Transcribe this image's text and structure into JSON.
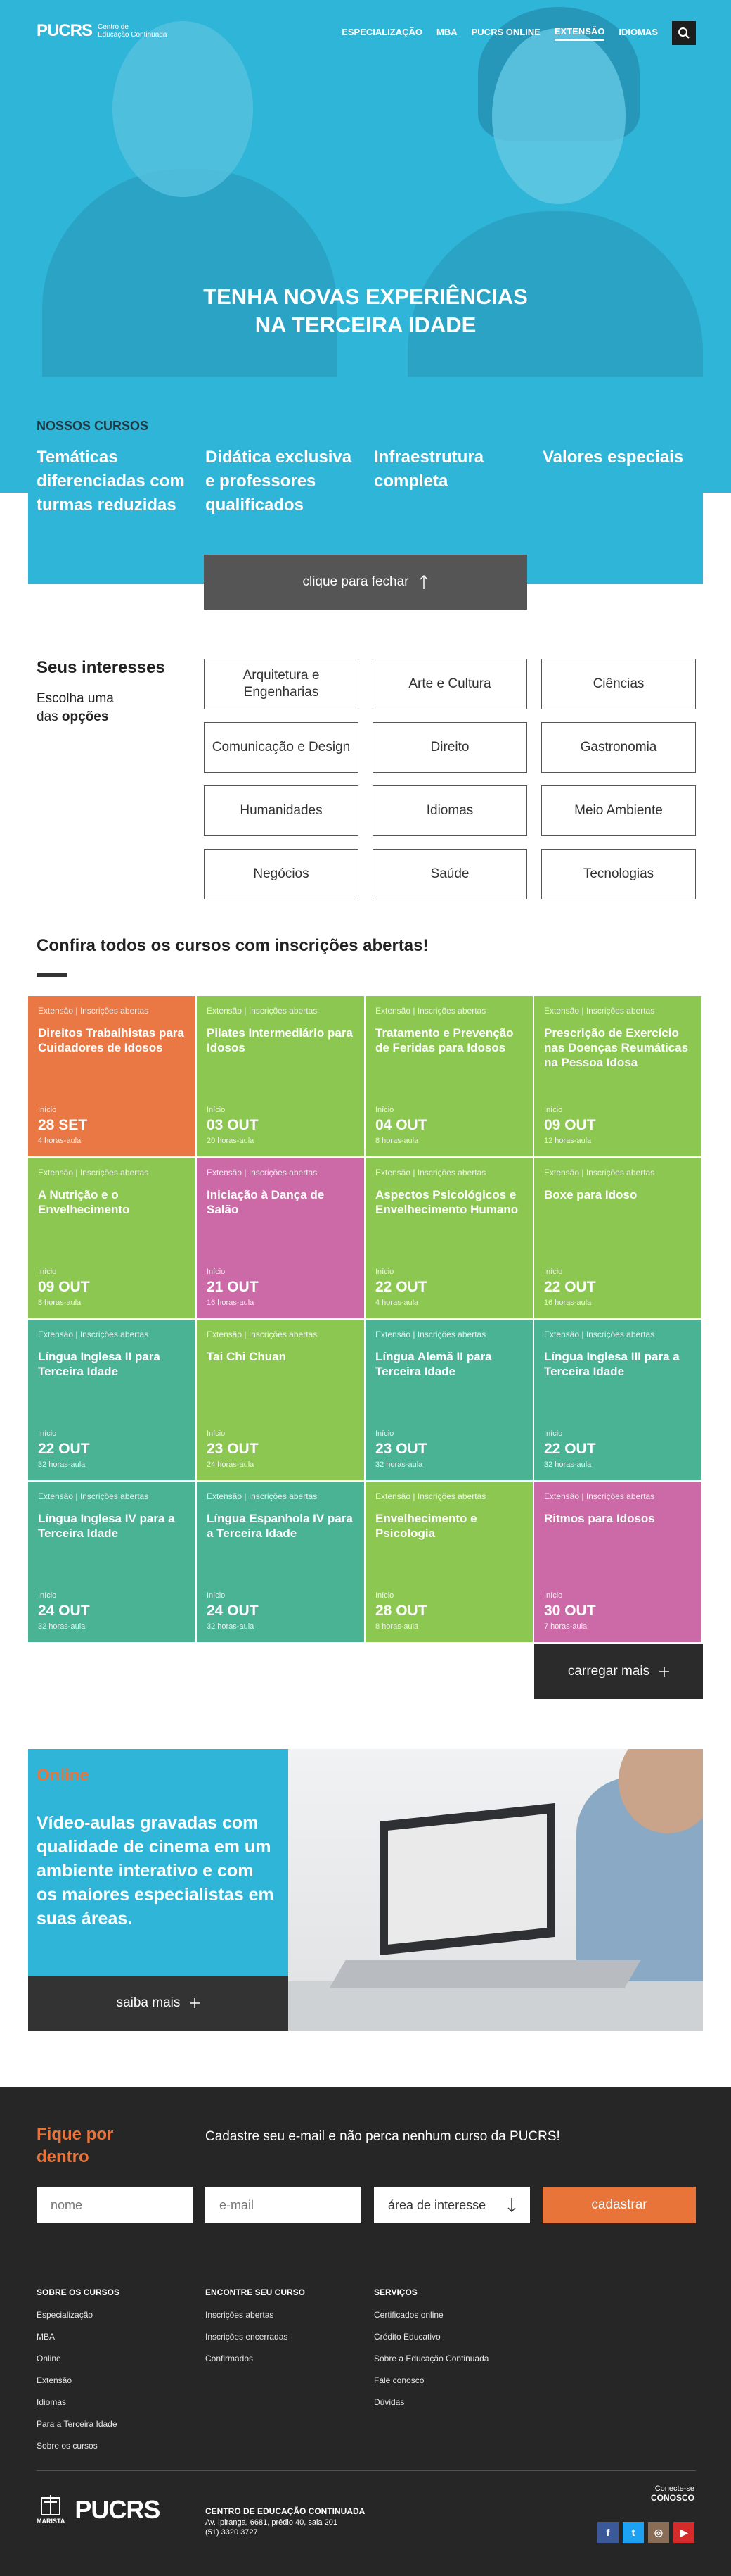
{
  "header": {
    "logo": "PUCRS",
    "logo_sub_line1": "Centro de",
    "logo_sub_line2": "Educação Continuada",
    "nav": [
      "ESPECIALIZAÇÃO",
      "MBA",
      "PUCRS ONLINE",
      "EXTENSÃO",
      "IDIOMAS"
    ],
    "active_nav": "EXTENSÃO"
  },
  "hero": {
    "title_line1": "TENHA NOVAS EXPERIÊNCIAS",
    "title_line2": "NA TERCEIRA IDADE"
  },
  "our_courses": {
    "heading": "NOSSOS CURSOS",
    "features": [
      "Temáticas diferenciadas com turmas reduzidas",
      "Didática exclusiva e professores qualificados",
      "Infraestrutura completa",
      "Valores especiais"
    ],
    "close_label": "clique para fechar",
    "close_icon": "arrow-up-icon"
  },
  "interests": {
    "title": "Seus interesses",
    "sub_line1": "Escolha uma",
    "sub_line2_prefix": "das ",
    "sub_line2_bold": "opções",
    "tags": [
      "Arquitetura e Engenharias",
      "Arte e Cultura",
      "Ciências",
      "Comunicação e Design",
      "Direito",
      "Gastronomia",
      "Humanidades",
      "Idiomas",
      "Meio Ambiente",
      "Negócios",
      "Saúde",
      "Tecnologias"
    ]
  },
  "open_courses": {
    "title": "Confira todos os cursos com inscrições abertas!",
    "meta": "Extensão | Inscrições abertas",
    "start_label": "Início",
    "cards": [
      {
        "title": "Direitos Trabalhistas para Cuidadores de Idosos",
        "date": "28 SET",
        "hours": "4 horas-aula",
        "color": "#ea7845"
      },
      {
        "title": "Pilates Intermediário para Idosos",
        "date": "03 OUT",
        "hours": "20 horas-aula",
        "color": "#8cc751"
      },
      {
        "title": "Tratamento e Prevenção de Feridas para Idosos",
        "date": "04 OUT",
        "hours": "8 horas-aula",
        "color": "#8cc751"
      },
      {
        "title": "Prescrição de Exercício nas Doenças Reumáticas na Pessoa Idosa",
        "date": "09 OUT",
        "hours": "12 horas-aula",
        "color": "#8cc751"
      },
      {
        "title": "A Nutrição e o Envelhecimento",
        "date": "09 OUT",
        "hours": "8 horas-aula",
        "color": "#8cc751"
      },
      {
        "title": "Iniciação à Dança de Salão",
        "date": "21 OUT",
        "hours": "16 horas-aula",
        "color": "#cb6aa6"
      },
      {
        "title": "Aspectos Psicológicos e Envelhecimento Humano",
        "date": "22 OUT",
        "hours": "4 horas-aula",
        "color": "#8cc751"
      },
      {
        "title": "Boxe para Idoso",
        "date": "22 OUT",
        "hours": "16 horas-aula",
        "color": "#8cc751"
      },
      {
        "title": "Língua Inglesa II para Terceira Idade",
        "date": "22 OUT",
        "hours": "32 horas-aula",
        "color": "#49b394"
      },
      {
        "title": "Tai Chi Chuan",
        "date": "23 OUT",
        "hours": "24 horas-aula",
        "color": "#8cc751"
      },
      {
        "title": "Língua Alemã II para Terceira Idade",
        "date": "23 OUT",
        "hours": "32 horas-aula",
        "color": "#49b394"
      },
      {
        "title": "Língua Inglesa III para a Terceira Idade",
        "date": "22 OUT",
        "hours": "32 horas-aula",
        "color": "#49b394"
      },
      {
        "title": "Língua Inglesa IV para a Terceira Idade",
        "date": "24 OUT",
        "hours": "32 horas-aula",
        "color": "#49b394"
      },
      {
        "title": "Língua Espanhola IV para a Terceira Idade",
        "date": "24 OUT",
        "hours": "32 horas-aula",
        "color": "#49b394"
      },
      {
        "title": "Envelhecimento e Psicologia",
        "date": "28 OUT",
        "hours": "8 horas-aula",
        "color": "#8cc751"
      },
      {
        "title": "Ritmos para Idosos",
        "date": "30 OUT",
        "hours": "7 horas-aula",
        "color": "#cb6aa6"
      }
    ],
    "load_more": "carregar mais",
    "load_icon": "plus-icon"
  },
  "online": {
    "tag": "Online",
    "text": "Vídeo-aulas gravadas com qualidade de cinema em um ambiente interativo e com os maiores especialistas em suas áreas.",
    "more_label": "saiba mais"
  },
  "newsletter": {
    "title_line1": "Fique por",
    "title_line2": "dentro",
    "text": "Cadastre seu e-mail e não perca nenhum curso da PUCRS!",
    "name_placeholder": "nome",
    "email_placeholder": "e-mail",
    "area_placeholder": "área de interesse",
    "submit": "cadastrar"
  },
  "footer": {
    "columns": [
      {
        "title": "SOBRE OS CURSOS",
        "links": [
          "Especialização",
          "MBA",
          "Online",
          "Extensão",
          "Idiomas",
          "Para a Terceira Idade",
          "Sobre os cursos"
        ]
      },
      {
        "title": "ENCONTRE SEU CURSO",
        "links": [
          "Inscrições abertas",
          "Inscrições encerradas",
          "Confirmados"
        ]
      },
      {
        "title": "SERVIÇOS",
        "links": [
          "Certificados online",
          "Crédito Educativo",
          "Sobre a Educação Continuada",
          "Fale conosco",
          "Dúvidas"
        ]
      }
    ],
    "marista": "MARISTA",
    "brand": "PUCRS",
    "org_name": "CENTRO DE EDUCAÇÃO CONTINUADA",
    "address": "Av. Ipiranga, 6681, prédio 40, sala 201",
    "phone": "(51) 3320 3727",
    "connect_line1": "Conecte-se",
    "connect_line2": "CONOSCO",
    "social": [
      "facebook-icon",
      "twitter-icon",
      "instagram-icon",
      "youtube-icon"
    ],
    "social_colors": [
      "#3b5998",
      "#1da1f2",
      "#8a6d57",
      "#d62b2b"
    ]
  }
}
